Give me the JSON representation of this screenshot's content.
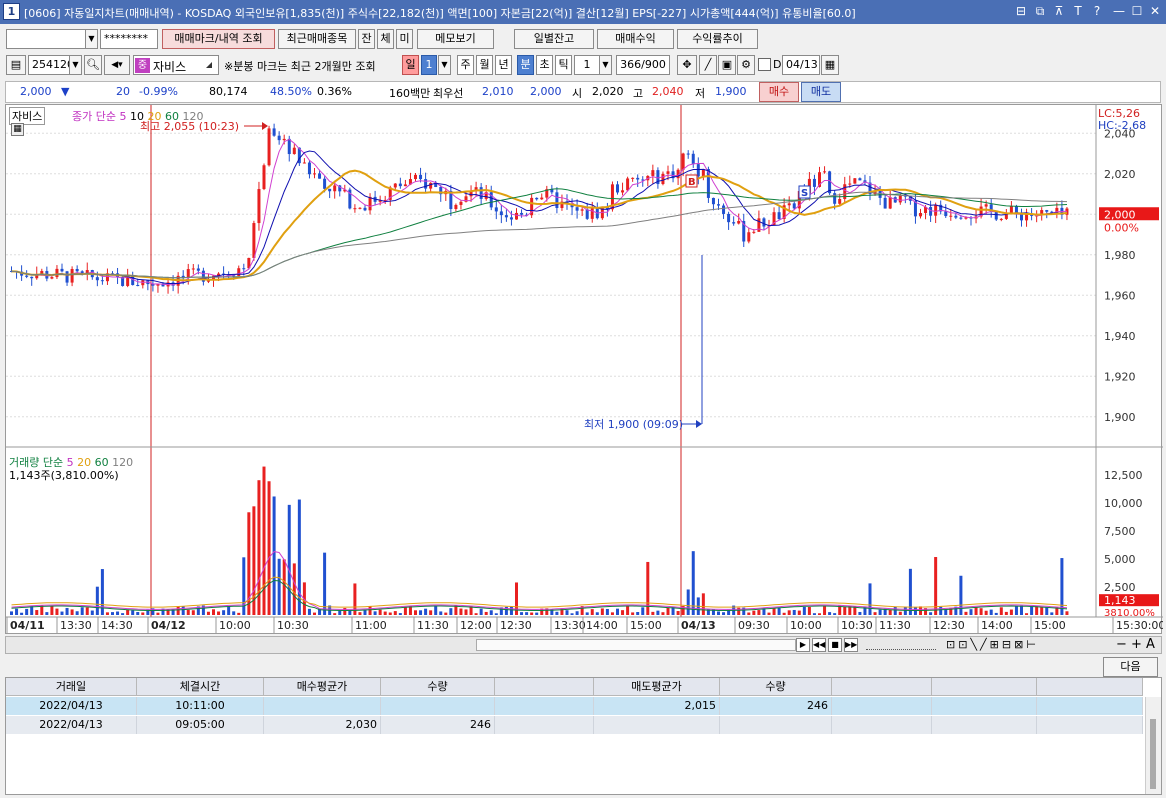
{
  "window": {
    "number": "1",
    "title": "[0606] 자동일지차트(매매내역) - KOSDAQ 외국인보유[1,835(천)] 주식수[22,182(천)] 액면[100] 자본금[22(억)] 결산[12월] EPS[-227] 시가총액[444(억)] 유통비율[60.0]"
  },
  "toolbar1": {
    "account": "",
    "password": "********",
    "btn_mark": "매매마크/내역 조회",
    "btn_recent": "최근매매종목",
    "btn_jan": "잔",
    "btn_che": "체",
    "btn_mi": "미",
    "btn_memo": "메모보기",
    "btn_daily": "일별잔고",
    "btn_profit": "매매수익",
    "btn_rate": "수익률추이"
  },
  "toolbar2": {
    "code": "254120",
    "stock_badge": "중",
    "stock_name": "자비스",
    "notice": "※분봉 마크는 최근 2개월만 조회",
    "period_tabs": [
      "일",
      "1",
      "주",
      "월",
      "년",
      "분",
      "초",
      "틱"
    ],
    "interval": "1",
    "count": "366/900",
    "date_check_label": "D",
    "date": "04/13"
  },
  "quote": {
    "price": "2,000",
    "arrow": "▼",
    "change": "20",
    "change_pct": "-0.99%",
    "volume": "80,174",
    "vol_ratio": "48.50%",
    "turnover": "0.36%",
    "amount": "160백만",
    "pref_label": "최우선",
    "bid": "2,010",
    "ask": "2,000",
    "open_label": "시",
    "open": "2,020",
    "high_label": "고",
    "high": "2,040",
    "low_label": "저",
    "low": "1,900",
    "buy_btn": "매수",
    "sell_btn": "매도"
  },
  "chart": {
    "price_panel": {
      "tag": "자비스",
      "legend_title": "종가 단순",
      "ma_periods": [
        "5",
        "10",
        "20",
        "60",
        "120"
      ],
      "ma_colors": [
        "#d040d0",
        "#1010b0",
        "#e0a010",
        "#108040",
        "#808080"
      ],
      "lc_label": "LC:5,26",
      "hc_label": "HC:-2,68",
      "high_annot": "최고 2,055 (10:23)",
      "low_annot": "최저 1,900 (09:09)",
      "price_box": "2,000",
      "pct_box": "0.00%",
      "mark_buy": "B",
      "mark_sell": "S"
    },
    "volume_panel": {
      "legend_title": "거래량 단순",
      "ma_periods": [
        "5",
        "20",
        "60",
        "120"
      ],
      "ma_colors": [
        "#d040d0",
        "#e0a010",
        "#108040",
        "#808080"
      ],
      "current": "1,143주(3,810.00%)",
      "vol_box": "1,143",
      "pct_box": "3810.00%"
    },
    "x_labels": [
      "04/11",
      "13:30",
      "14:30",
      "04/12",
      "10:00",
      "10:30",
      "11:00",
      "11:30",
      "12:00",
      "12:30",
      "13:30",
      "14:00",
      "15:00",
      "04/13",
      "09:30",
      "10:00",
      "10:30",
      "11:30",
      "12:30",
      "14:00",
      "15:00",
      "15:30:00"
    ],
    "colors": {
      "up": "#e82020",
      "down": "#2050d0",
      "grid": "#dddddd",
      "vline": "#d02020"
    }
  },
  "chart_data": {
    "type": "candlestick",
    "ylim": [
      1890,
      2050
    ],
    "yticks": [
      "2,040",
      "2,020",
      "2,000",
      "1,980",
      "1,960",
      "1,940",
      "1,920",
      "1,900"
    ],
    "vol_yticks": [
      "12,500",
      "10,000",
      "7,500",
      "5,000",
      "2,500"
    ],
    "high": 2055,
    "low": 1900,
    "last": 2000,
    "last_volume": 1143
  },
  "table": {
    "next_btn": "다음",
    "headers": [
      "거래일",
      "체결시간",
      "매수평균가",
      "수량",
      "",
      "매도평균가",
      "수량",
      "",
      "",
      ""
    ],
    "rows": [
      [
        "2022/04/13",
        "10:11:00",
        "",
        "",
        "",
        "2,015",
        "246",
        "",
        "",
        ""
      ],
      [
        "2022/04/13",
        "09:05:00",
        "2,030",
        "246",
        "",
        "",
        "",
        "",
        "",
        ""
      ]
    ]
  }
}
